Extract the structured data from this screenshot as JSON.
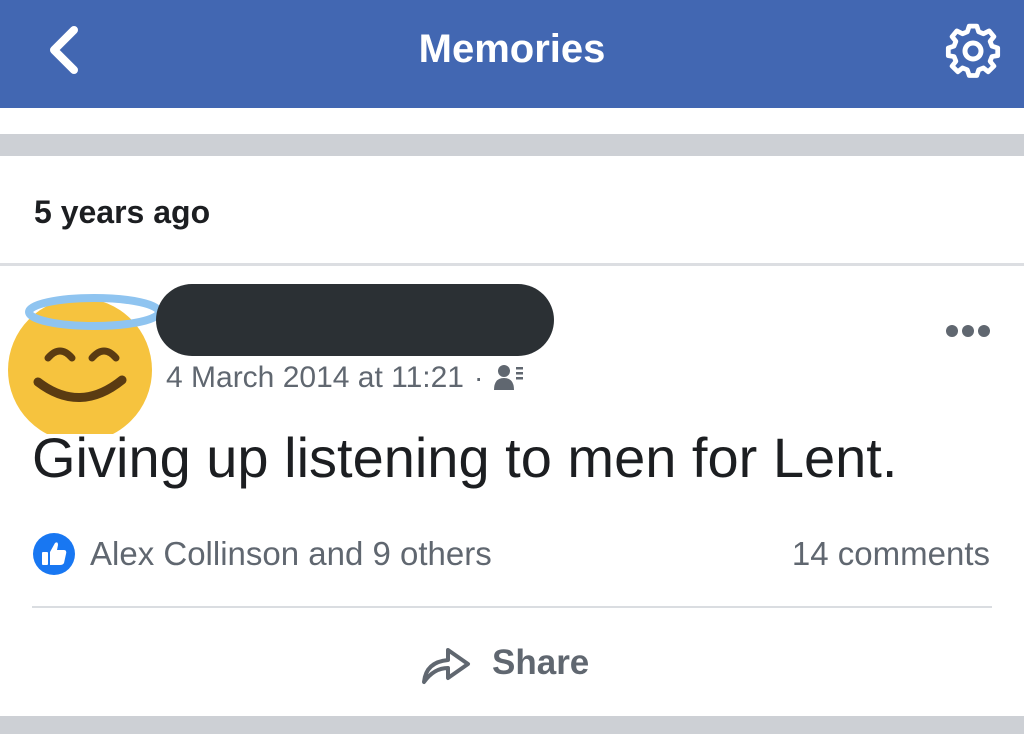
{
  "navbar": {
    "title": "Memories",
    "back_icon": "chevron-left-icon",
    "settings_icon": "gear-icon",
    "background_color": "#4267b2"
  },
  "section": {
    "header": "5 years ago"
  },
  "post": {
    "avatar_icon": "smiling-face-with-halo-emoji",
    "author_name": "[redacted]",
    "timestamp": "4 March 2014 at 11:21",
    "separator": "·",
    "audience_icon": "friends-audience-icon",
    "more_icon": "more-options-icon",
    "text": "Giving up listening to men for Lent.",
    "reactions": {
      "icon": "like-icon",
      "summary": "Alex Collinson and 9 others"
    },
    "comments": "14 comments",
    "share": {
      "icon": "share-arrow-icon",
      "label": "Share"
    }
  },
  "colors": {
    "accent": "#4267b2",
    "like_blue": "#1877f2",
    "secondary_text": "#606770",
    "primary_text": "#1c1e21",
    "separator_grey": "#cdd0d5"
  }
}
